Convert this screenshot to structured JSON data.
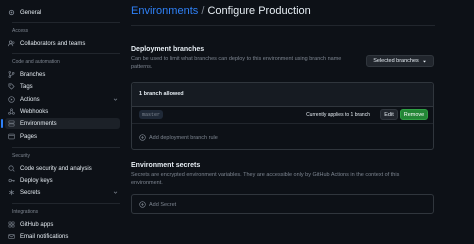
{
  "sidebar": {
    "general": "General",
    "access_heading": "Access",
    "collaborators": "Collaborators and teams",
    "code_heading": "Code and automation",
    "branches": "Branches",
    "tags": "Tags",
    "actions": "Actions",
    "webhooks": "Webhooks",
    "environments": "Environments",
    "pages": "Pages",
    "security_heading": "Security",
    "code_security": "Code security and analysis",
    "deploy_keys": "Deploy keys",
    "secrets": "Secrets",
    "integrations_heading": "Integrations",
    "github_apps": "GitHub apps",
    "email_notifications": "Email notifications"
  },
  "header": {
    "breadcrumb": "Environments",
    "separator": "/",
    "title": "Configure Production"
  },
  "deployment_branches": {
    "heading": "Deployment branches",
    "description": "Can be used to limit what branches can deploy to this environment using branch name patterns.",
    "dropdown_label": "Selected branches",
    "allowed_count": "1 branch allowed",
    "branch_name": "master",
    "applies_text": "Currently applies to 1 branch",
    "edit_label": "Edit",
    "remove_label": "Remove",
    "add_rule_label": "Add deployment branch rule"
  },
  "environment_secrets": {
    "heading": "Environment secrets",
    "description": "Secrets are encrypted environment variables. They are accessible only by GitHub Actions in the context of this environment.",
    "add_secret_label": "Add Secret"
  },
  "colors": {
    "background": "#0d1117",
    "accent": "#2f81f7",
    "remove_button": "#238636",
    "muted_text": "#7d8590"
  }
}
